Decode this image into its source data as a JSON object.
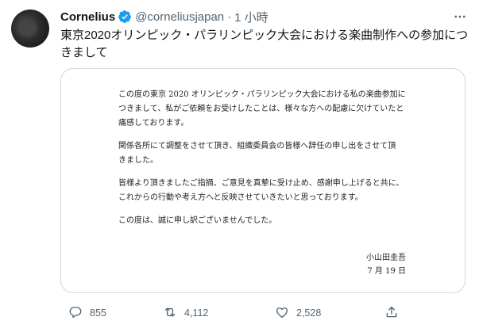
{
  "tweet": {
    "display_name": "Cornelius",
    "handle": "@corneliusjapan",
    "separator": "·",
    "time": "1 小時",
    "text": "東京2020オリンピック・パラリンピック大会における楽曲制作への参加につきまして"
  },
  "statement": {
    "paragraphs": [
      [
        "この度の東京 2020 オリンピック・パラリンピック大会における私の楽曲参加に",
        "つきまして、私がご依頼をお受けしたことは、様々な方への配慮に欠けていたと",
        "痛感しております。"
      ],
      [
        "関係各所にて調整をさせて頂き、組織委員会の皆様へ辞任の申し出をさせて頂",
        "きました。"
      ],
      [
        "皆様より頂きましたご指摘、ご意見を真摯に受け止め、感謝申し上げると共に、",
        "これからの行動や考え方へと反映させていきたいと思っております。"
      ],
      [
        "この度は、誠に申し訳ございませんでした。"
      ]
    ],
    "signature_name": "小山田圭吾",
    "signature_date": "7 月 19 日"
  },
  "actions": {
    "reply_count": "855",
    "retweet_count": "4,112",
    "like_count": "2,528"
  },
  "icons": {
    "verified": "verified-badge-icon",
    "more": "more-icon",
    "reply": "reply-icon",
    "retweet": "retweet-icon",
    "like": "like-icon",
    "share": "share-icon"
  },
  "colors": {
    "verified_blue": "#1d9bf0",
    "muted": "#536471",
    "text": "#0f1419",
    "border": "#cfd9de"
  }
}
